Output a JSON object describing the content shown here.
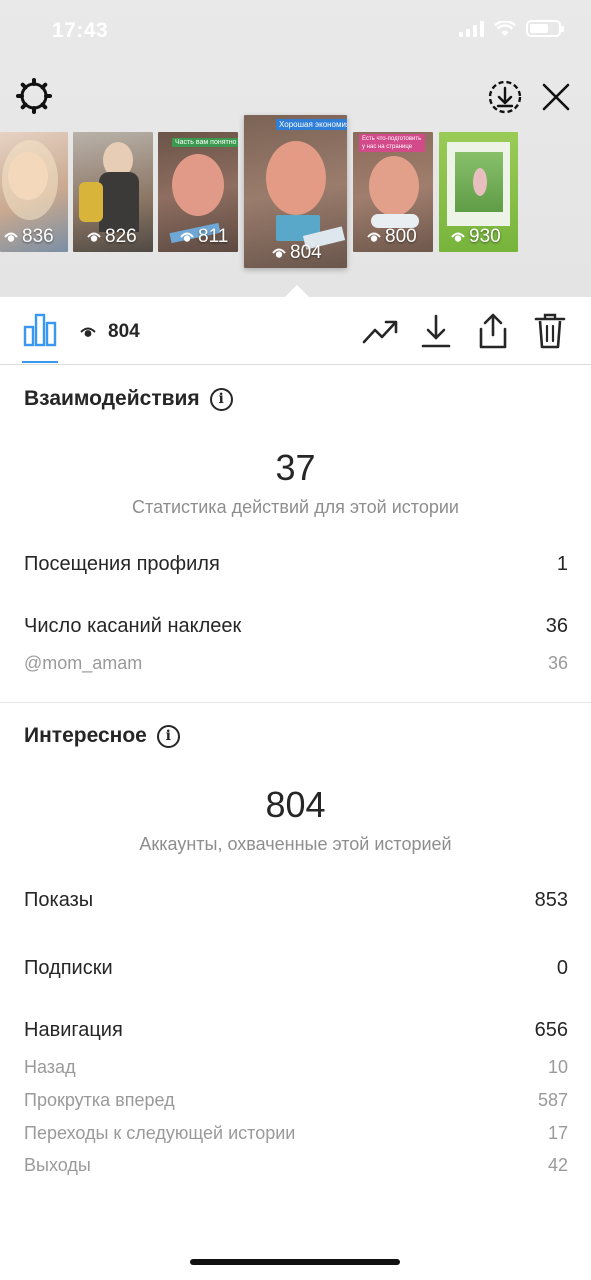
{
  "status_bar": {
    "time": "17:43"
  },
  "tray": {
    "stories": [
      {
        "views": "836",
        "caption": ""
      },
      {
        "views": "826",
        "caption": ""
      },
      {
        "views": "811",
        "caption": "Часть вам понятно"
      },
      {
        "views": "804",
        "caption": "Хорошая экономия!"
      },
      {
        "views": "800",
        "caption": "Есть что-подготовить у нас на странице"
      },
      {
        "views": "930",
        "caption": ""
      }
    ]
  },
  "toolbar": {
    "reach_count": "804"
  },
  "interactions": {
    "title": "Взаимодействия",
    "total": "37",
    "total_caption": "Статистика действий для этой истории",
    "rows": [
      {
        "label": "Посещения профиля",
        "value": "1"
      },
      {
        "label": "Число касаний наклеек",
        "value": "36"
      }
    ],
    "sticker": {
      "label": "@mom_amam",
      "value": "36"
    }
  },
  "discovery": {
    "title": "Интересное",
    "total": "804",
    "total_caption": "Аккаунты, охваченные этой историей",
    "impressions": {
      "label": "Показы",
      "value": "853"
    },
    "follows": {
      "label": "Подписки",
      "value": "0"
    },
    "navigation": {
      "label": "Навигация",
      "value": "656"
    },
    "nav_rows": [
      {
        "label": "Назад",
        "value": "10"
      },
      {
        "label": "Прокрутка вперед",
        "value": "587"
      },
      {
        "label": "Переходы к следующей истории",
        "value": "17"
      },
      {
        "label": "Выходы",
        "value": "42"
      }
    ]
  },
  "colors": {
    "accent": "#3897f0",
    "text": "#262626",
    "muted": "#8e8e8e"
  }
}
